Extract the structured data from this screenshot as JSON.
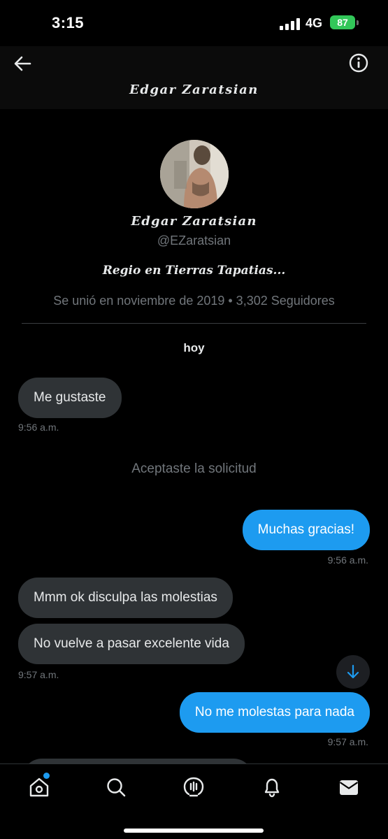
{
  "status_bar": {
    "time": "3:15",
    "network": "4G",
    "battery": "87"
  },
  "header": {
    "title": "Edgar Zaratsian"
  },
  "profile": {
    "name": "Edgar Zaratsian",
    "handle": "@EZaratsian",
    "bio": "Regio en Tierras Tapatias...",
    "meta": "Se unió en noviembre de 2019 • 3,302 Seguidores"
  },
  "conversation": {
    "date_label": "hoy",
    "system_message": "Aceptaste la solicitud",
    "messages": [
      {
        "text": "Me gustaste",
        "time": "9:56 a.m."
      },
      {
        "text": "Muchas gracias!",
        "time": "9:56 a.m."
      },
      {
        "text": "Mmm ok disculpa las molestias"
      },
      {
        "text": "No vuelve a pasar excelente vida",
        "time": "9:57 a.m."
      },
      {
        "text": "No me molestas para nada",
        "time": "9:57 a.m."
      }
    ]
  },
  "tabs": [
    {
      "icon": "home-icon",
      "has_notification": true
    },
    {
      "icon": "search-icon"
    },
    {
      "icon": "spaces-icon"
    },
    {
      "icon": "bell-icon"
    },
    {
      "icon": "mail-icon"
    }
  ],
  "colors": {
    "accent": "#1d9bf0",
    "incoming_bubble": "#2f3336",
    "muted_text": "#71767b",
    "battery": "#32c759"
  }
}
